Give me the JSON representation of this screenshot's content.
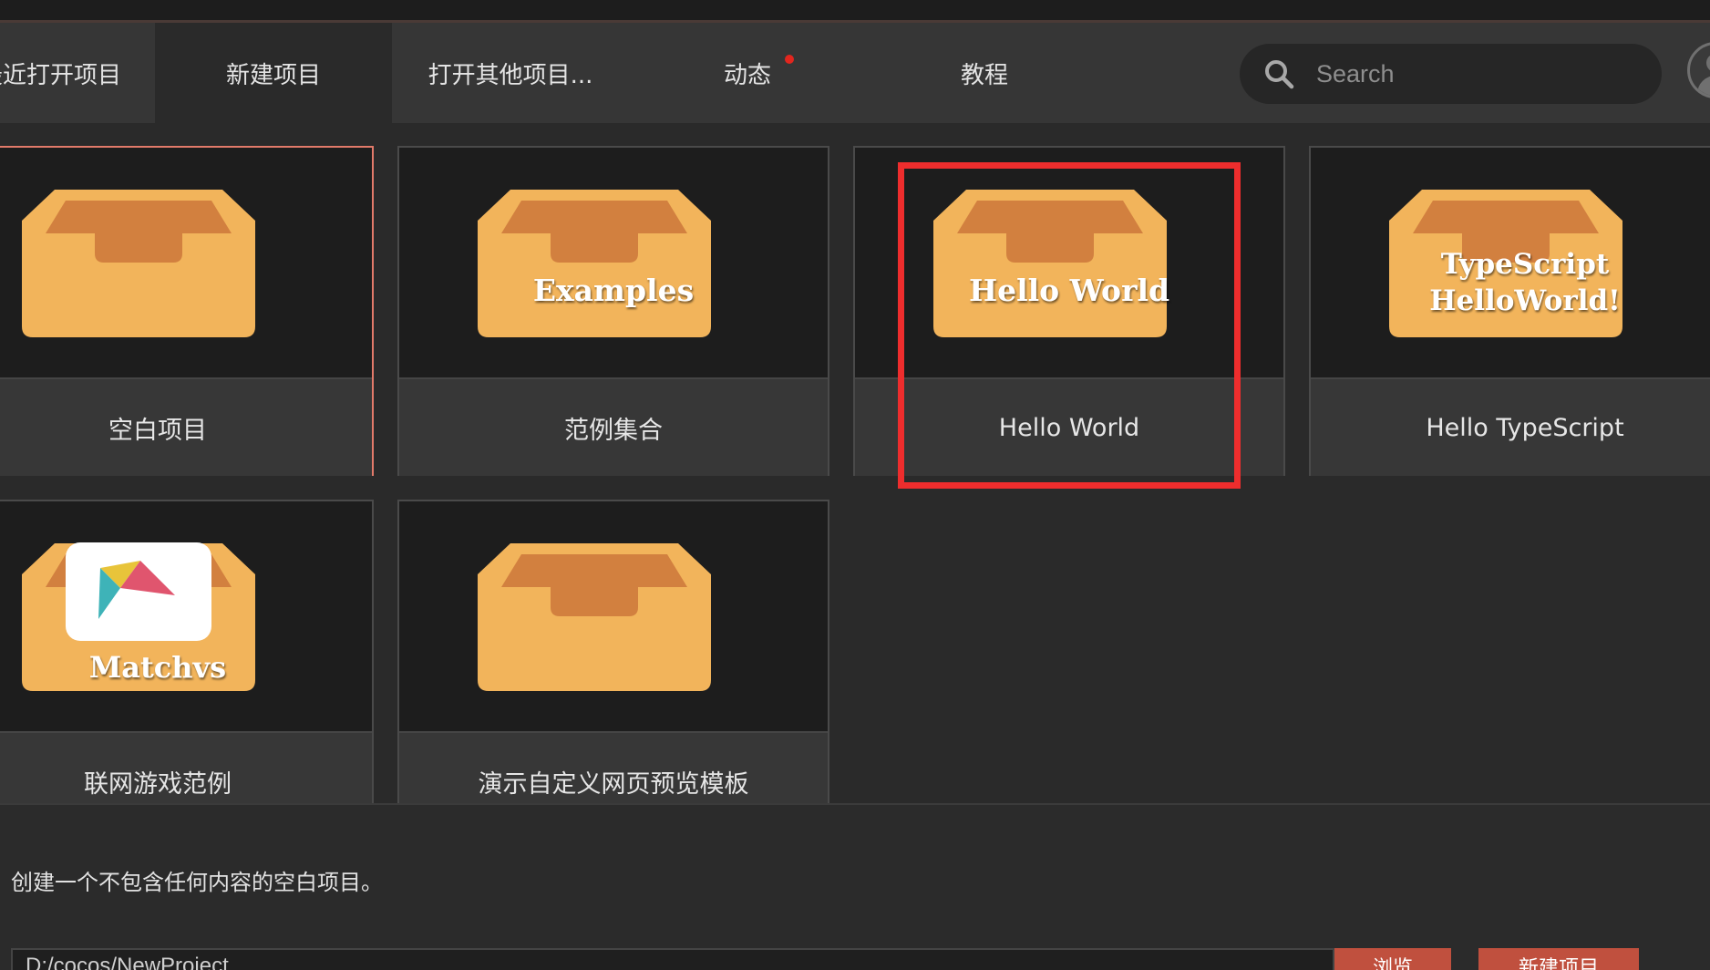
{
  "tabs": [
    {
      "label": "最近打开项目",
      "active": false
    },
    {
      "label": "新建项目",
      "active": true
    },
    {
      "label": "打开其他项目...",
      "active": false
    },
    {
      "label": "动态",
      "active": false,
      "has_notification": true
    },
    {
      "label": "教程",
      "active": false
    }
  ],
  "search": {
    "placeholder": "Search"
  },
  "templates": [
    {
      "label": "空白项目",
      "box_text": "",
      "selected": true
    },
    {
      "label": "范例集合",
      "box_text": "Examples",
      "selected": false
    },
    {
      "label": "Hello World",
      "box_text": "Hello World",
      "selected": false,
      "highlighted": true
    },
    {
      "label": "Hello TypeScript",
      "box_text_line1": "TypeScript",
      "box_text_line2": "HelloWorld!",
      "selected": false
    },
    {
      "label": "联网游戏范例",
      "box_text": "Matchvs",
      "selected": false
    },
    {
      "label": "演示自定义网页预览模板",
      "box_text": "",
      "selected": false
    }
  ],
  "description": "创建一个不包含任何内容的空白项目。",
  "project_path": "D:/cocos/NewProject",
  "buttons": {
    "browse": "浏览",
    "create": "新建项目"
  },
  "colors": {
    "box_light": "#f2b45b",
    "box_dark": "#d2803f",
    "highlight": "#ee2d2d",
    "selected_border": "#e27a6a",
    "accent_button": "#c0503e",
    "notification_dot": "#e2261e"
  }
}
